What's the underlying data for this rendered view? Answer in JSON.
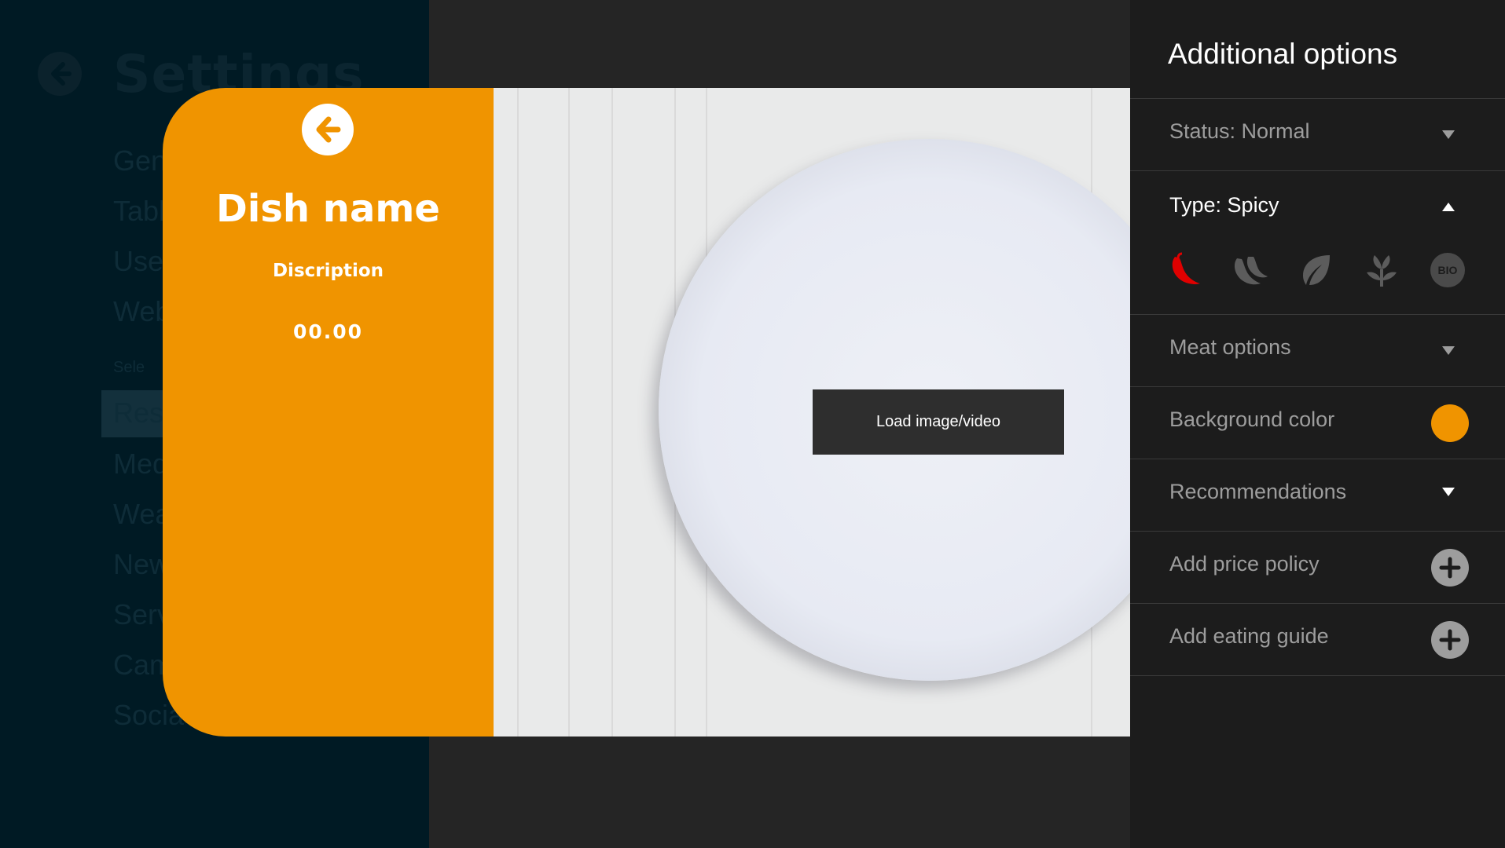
{
  "background": {
    "title": "Settings",
    "menu_items": [
      "Gen",
      "Tabl",
      "User",
      "Web",
      "Sele",
      "Rest",
      "Med",
      "Wea",
      "New",
      "Serv",
      "Cam",
      "Socia"
    ]
  },
  "dish": {
    "name": "Dish name",
    "description": "Discription",
    "price": "00.00",
    "load_button": "Load image/video"
  },
  "options": {
    "title": "Additional options",
    "status": "Status: Normal",
    "type": "Type: Spicy",
    "type_icons": [
      "chili-icon",
      "double-chili-icon",
      "leaf-icon",
      "sprout-icon",
      "bio-icon"
    ],
    "bio_label": "BIO",
    "meat": "Meat options",
    "background_color": "Background color",
    "background_color_value": "#f09400",
    "recommendations": "Recommendations",
    "price_policy": "Add price policy",
    "eating_guide": "Add eating guide"
  },
  "colors": {
    "accent": "#f09400",
    "spicy_active": "#e00000",
    "panel_bg": "#1c1c1c"
  }
}
